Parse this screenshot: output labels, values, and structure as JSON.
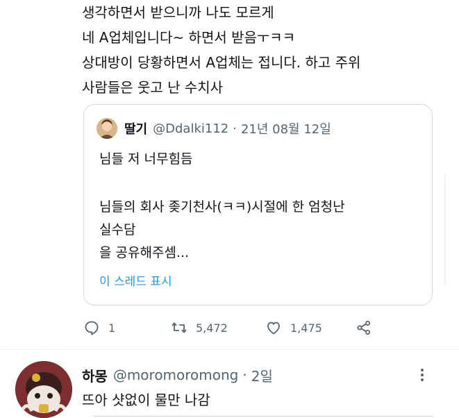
{
  "tweet": {
    "lines": [
      "생각하면서 받으니까 나도 모르게",
      "네 A업체입니다~ 하면서 받음ㅜㅋㅋ",
      "상대방이 당황하면서 A업체는 접니다. 하고 주위",
      "사람들은 웃고 난 수치사"
    ]
  },
  "quote": {
    "name": "딸기",
    "handle": "@Ddalki112",
    "separator": "·",
    "date": "21년 08월 12일",
    "line1": "님들 저 너무힘듬",
    "line2": "님들의 회사 좆기천사(ㅋㅋ)시절에 한 엄청난",
    "line3": "실수담",
    "line4": "을 공유해주셈...",
    "show_thread": "이 스레드 표시"
  },
  "actions": {
    "replies": "1",
    "retweets": "5,472",
    "likes": "1,475"
  },
  "reply": {
    "name": "하몽",
    "handle": "@moromoromong",
    "separator": "·",
    "time": "2일",
    "text": "뜨아 샷없이 물만 나감"
  },
  "colors": {
    "text": "#0f1419",
    "secondary": "#536471",
    "link": "#1d9bf0",
    "border": "#cfd9de"
  }
}
